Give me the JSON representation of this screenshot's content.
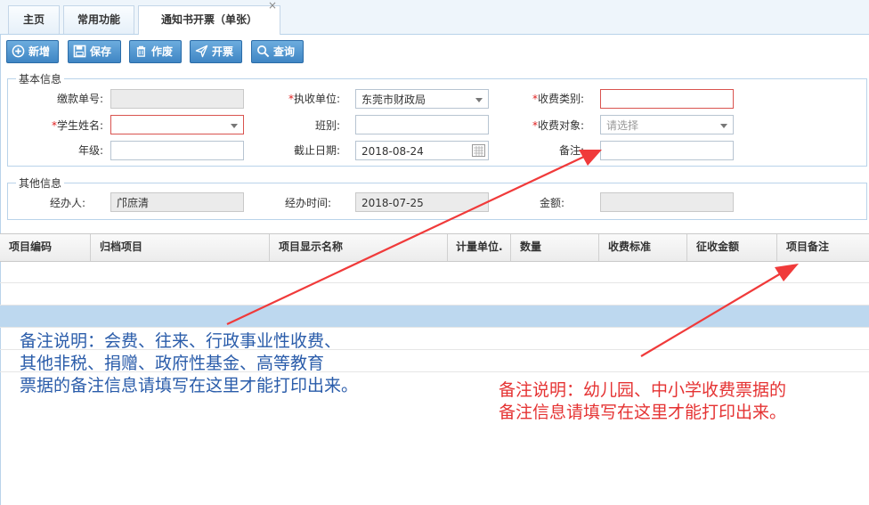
{
  "tabs": [
    {
      "label": "主页"
    },
    {
      "label": "常用功能"
    },
    {
      "label": "通知书开票（单张）",
      "close": "×"
    }
  ],
  "toolbar": {
    "add": "新增",
    "save": "保存",
    "void": "作废",
    "issue": "开票",
    "query": "查询"
  },
  "basic": {
    "legend": "基本信息",
    "payment_no_label": "缴款单号:",
    "payment_no_value": "",
    "exec_unit_label": "执收单位:",
    "exec_unit_value": "东莞市财政局",
    "fee_type_label": "收费类别:",
    "fee_type_value": "",
    "student_name_label": "学生姓名:",
    "student_name_value": "",
    "class_label": "班别:",
    "class_value": "",
    "fee_target_label": "收费对象:",
    "fee_target_placeholder": "请选择",
    "grade_label": "年级:",
    "grade_value": "",
    "deadline_label": "截止日期:",
    "deadline_value": "2018-08-24",
    "remark_label": "备注:",
    "remark_value": "",
    "required_mark": "*"
  },
  "other": {
    "legend": "其他信息",
    "handler_label": "经办人:",
    "handler_value": "邝庶清",
    "handle_time_label": "经办时间:",
    "handle_time_value": "2018-07-25",
    "amount_label": "金额:",
    "amount_value": ""
  },
  "grid": {
    "columns": [
      "项目编码",
      "归档项目",
      "项目显示名称",
      "计量单位.",
      "数量",
      "收费标准",
      "征收金额",
      "项目备注"
    ],
    "rows": [
      [],
      [],
      [],
      [],
      []
    ],
    "selected_row": 2
  },
  "annotations": {
    "blue_lines": [
      "备注说明：会费、往来、行政事业性收费、",
      "其他非税、捐赠、政府性基金、高等教育",
      "票据的备注信息请填写在这里才能打印出来。"
    ],
    "red_lines": [
      "备注说明：幼儿园、中小学收费票据的",
      "备注信息请填写在这里才能打印出来。"
    ]
  },
  "colors": {
    "accent": "#3f86c4",
    "required": "#e02020",
    "annotation_blue": "#2a5caa",
    "annotation_red": "#e53333",
    "arrow": "#f03a3a",
    "selected_row": "#bdd8ef"
  }
}
